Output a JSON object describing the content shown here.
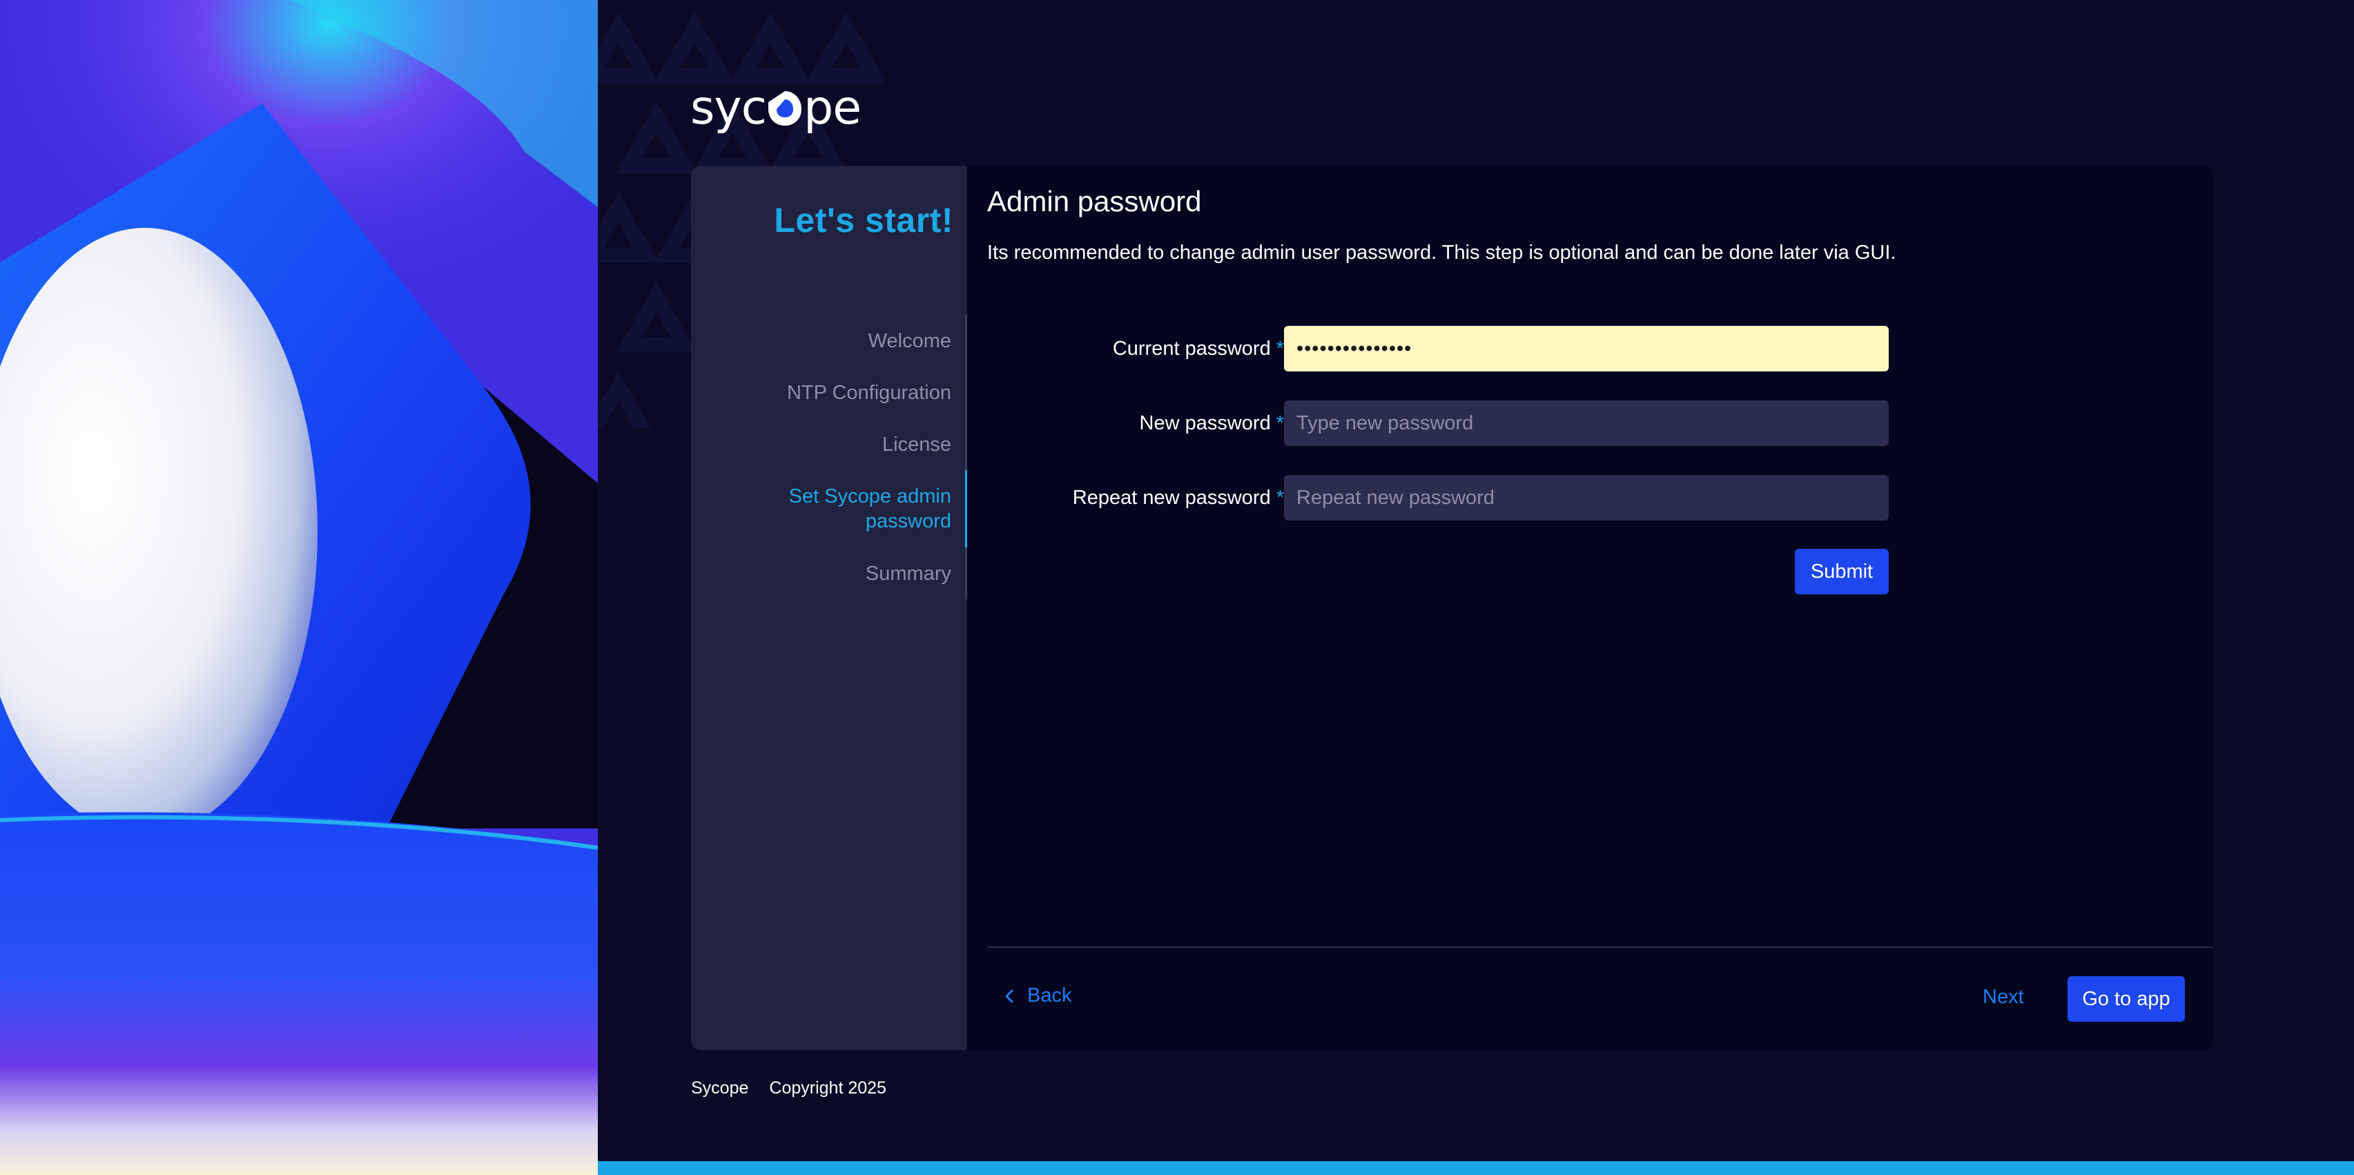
{
  "brand": {
    "logo_left": "syc",
    "logo_right": "pe"
  },
  "sidebar": {
    "title": "Let's start!",
    "steps": [
      {
        "label": "Welcome"
      },
      {
        "label": "NTP Configuration"
      },
      {
        "label": "License"
      },
      {
        "label": "Set Sycope admin password"
      },
      {
        "label": "Summary"
      }
    ],
    "active_step": 3
  },
  "main": {
    "heading": "Admin password",
    "description": "Its recommended to change admin user password. This step is optional and can be done later via GUI.",
    "form": {
      "current_password": {
        "label": "Current password",
        "required_mark": "*",
        "value": "•••••••••••••••"
      },
      "new_password": {
        "label": "New password",
        "required_mark": "*",
        "placeholder": "Type new password"
      },
      "repeat_password": {
        "label": "Repeat new password",
        "required_mark": "*",
        "placeholder": "Repeat new password"
      },
      "submit_label": "Submit"
    }
  },
  "footer_nav": {
    "back_label": "Back",
    "next_label": "Next",
    "go_to_app_label": "Go to app"
  },
  "page_footer": {
    "brand": "Sycope",
    "copyright": "Copyright 2025"
  },
  "colors": {
    "accent": "#1ea8e6",
    "primary_button": "#1d47ef",
    "link": "#1f7cf0",
    "background": "#080a26"
  }
}
